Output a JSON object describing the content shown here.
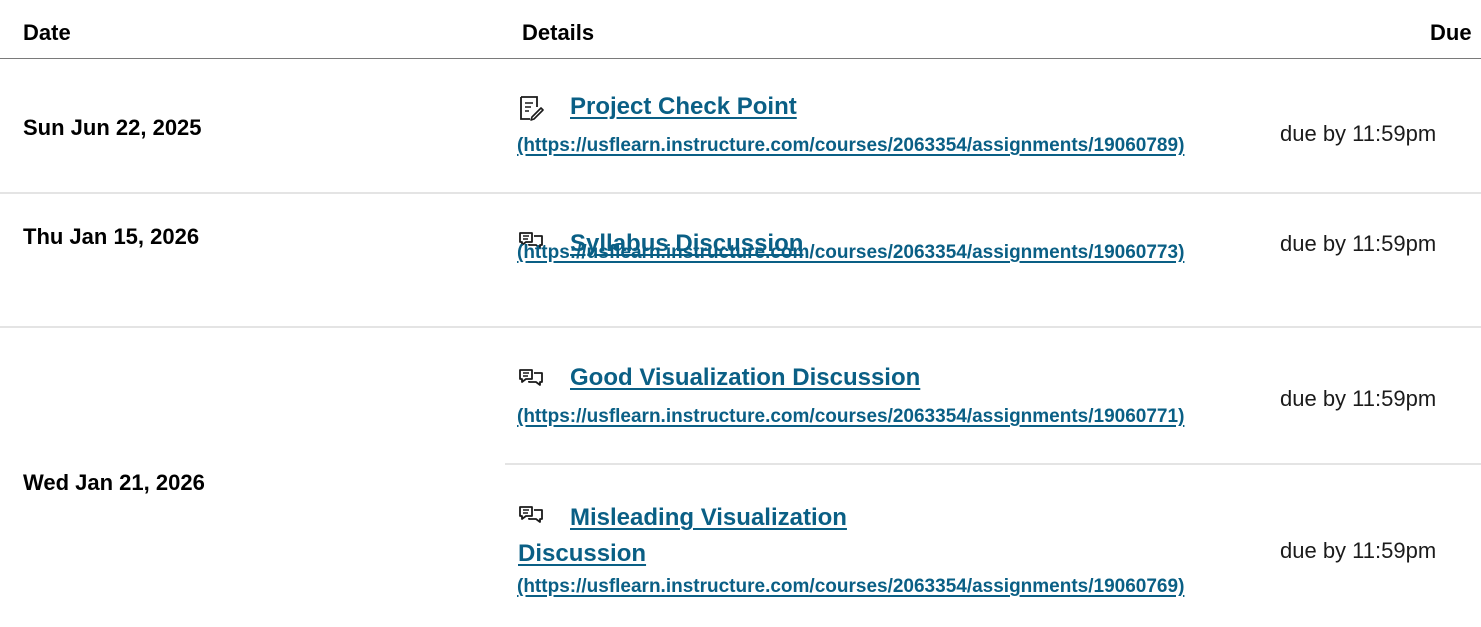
{
  "table": {
    "headers": {
      "date": "Date",
      "details": "Details",
      "due": "Due"
    },
    "rows": [
      {
        "date": "Sun Jun 22, 2025",
        "items": [
          {
            "icon": "assignment-icon",
            "title": "Project Check Point",
            "url": "(https://usflearn.instructure.com/courses/2063354/assignments/19060789)",
            "due": "due by 11:59pm"
          }
        ]
      },
      {
        "date": "Thu Jan 15, 2026",
        "items": [
          {
            "icon": "discussion-icon",
            "title": "Syllabus Discussion",
            "url": "(https://usflearn.instructure.com/courses/2063354/assignments/19060773)",
            "due": "due by 11:59pm"
          }
        ]
      },
      {
        "date": "Wed Jan 21, 2026",
        "items": [
          {
            "icon": "discussion-icon",
            "title": "Good Visualization Discussion",
            "url": "(https://usflearn.instructure.com/courses/2063354/assignments/19060771)",
            "due": "due by 11:59pm"
          },
          {
            "icon": "discussion-icon",
            "title": "Misleading Visualization Discussion",
            "url": "(https://usflearn.instructure.com/courses/2063354/assignments/19060769)",
            "due": "due by 11:59pm"
          }
        ]
      }
    ],
    "colors": {
      "link": "#0a5f85",
      "header_rule": "#7a7a7a",
      "row_rule": "#e4e4e4"
    }
  }
}
